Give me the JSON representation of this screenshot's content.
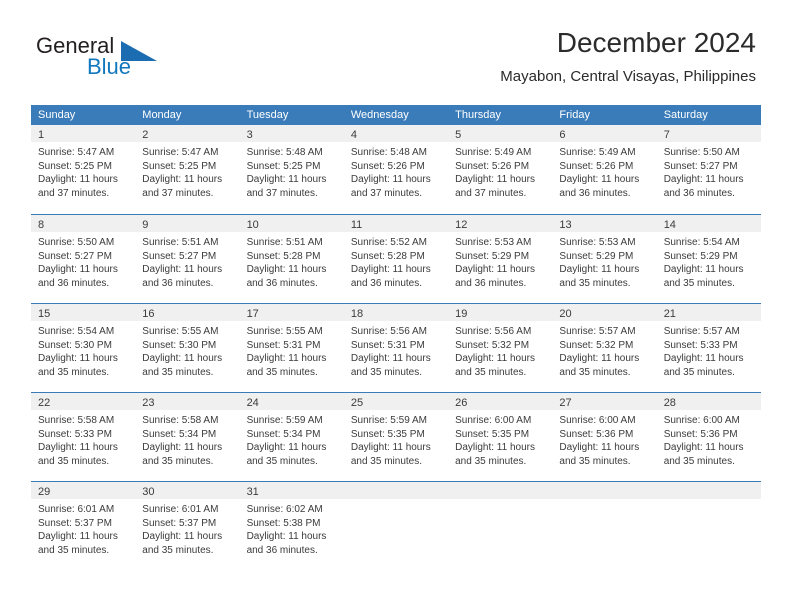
{
  "brand": {
    "name_top": "General",
    "name_bottom": "Blue",
    "accent_color": "#1b6cb0",
    "text_color": "#231f20"
  },
  "header": {
    "title": "December 2024",
    "subtitle": "Mayabon, Central Visayas, Philippines"
  },
  "calendar": {
    "header_bg": "#3a7cba",
    "daynum_bg": "#f0f0f0",
    "weekday_headers": [
      "Sunday",
      "Monday",
      "Tuesday",
      "Wednesday",
      "Thursday",
      "Friday",
      "Saturday"
    ],
    "weeks": [
      [
        {
          "day": "1",
          "lines": [
            "Sunrise: 5:47 AM",
            "Sunset: 5:25 PM",
            "Daylight: 11 hours",
            "and 37 minutes."
          ]
        },
        {
          "day": "2",
          "lines": [
            "Sunrise: 5:47 AM",
            "Sunset: 5:25 PM",
            "Daylight: 11 hours",
            "and 37 minutes."
          ]
        },
        {
          "day": "3",
          "lines": [
            "Sunrise: 5:48 AM",
            "Sunset: 5:25 PM",
            "Daylight: 11 hours",
            "and 37 minutes."
          ]
        },
        {
          "day": "4",
          "lines": [
            "Sunrise: 5:48 AM",
            "Sunset: 5:26 PM",
            "Daylight: 11 hours",
            "and 37 minutes."
          ]
        },
        {
          "day": "5",
          "lines": [
            "Sunrise: 5:49 AM",
            "Sunset: 5:26 PM",
            "Daylight: 11 hours",
            "and 37 minutes."
          ]
        },
        {
          "day": "6",
          "lines": [
            "Sunrise: 5:49 AM",
            "Sunset: 5:26 PM",
            "Daylight: 11 hours",
            "and 36 minutes."
          ]
        },
        {
          "day": "7",
          "lines": [
            "Sunrise: 5:50 AM",
            "Sunset: 5:27 PM",
            "Daylight: 11 hours",
            "and 36 minutes."
          ]
        }
      ],
      [
        {
          "day": "8",
          "lines": [
            "Sunrise: 5:50 AM",
            "Sunset: 5:27 PM",
            "Daylight: 11 hours",
            "and 36 minutes."
          ]
        },
        {
          "day": "9",
          "lines": [
            "Sunrise: 5:51 AM",
            "Sunset: 5:27 PM",
            "Daylight: 11 hours",
            "and 36 minutes."
          ]
        },
        {
          "day": "10",
          "lines": [
            "Sunrise: 5:51 AM",
            "Sunset: 5:28 PM",
            "Daylight: 11 hours",
            "and 36 minutes."
          ]
        },
        {
          "day": "11",
          "lines": [
            "Sunrise: 5:52 AM",
            "Sunset: 5:28 PM",
            "Daylight: 11 hours",
            "and 36 minutes."
          ]
        },
        {
          "day": "12",
          "lines": [
            "Sunrise: 5:53 AM",
            "Sunset: 5:29 PM",
            "Daylight: 11 hours",
            "and 36 minutes."
          ]
        },
        {
          "day": "13",
          "lines": [
            "Sunrise: 5:53 AM",
            "Sunset: 5:29 PM",
            "Daylight: 11 hours",
            "and 35 minutes."
          ]
        },
        {
          "day": "14",
          "lines": [
            "Sunrise: 5:54 AM",
            "Sunset: 5:29 PM",
            "Daylight: 11 hours",
            "and 35 minutes."
          ]
        }
      ],
      [
        {
          "day": "15",
          "lines": [
            "Sunrise: 5:54 AM",
            "Sunset: 5:30 PM",
            "Daylight: 11 hours",
            "and 35 minutes."
          ]
        },
        {
          "day": "16",
          "lines": [
            "Sunrise: 5:55 AM",
            "Sunset: 5:30 PM",
            "Daylight: 11 hours",
            "and 35 minutes."
          ]
        },
        {
          "day": "17",
          "lines": [
            "Sunrise: 5:55 AM",
            "Sunset: 5:31 PM",
            "Daylight: 11 hours",
            "and 35 minutes."
          ]
        },
        {
          "day": "18",
          "lines": [
            "Sunrise: 5:56 AM",
            "Sunset: 5:31 PM",
            "Daylight: 11 hours",
            "and 35 minutes."
          ]
        },
        {
          "day": "19",
          "lines": [
            "Sunrise: 5:56 AM",
            "Sunset: 5:32 PM",
            "Daylight: 11 hours",
            "and 35 minutes."
          ]
        },
        {
          "day": "20",
          "lines": [
            "Sunrise: 5:57 AM",
            "Sunset: 5:32 PM",
            "Daylight: 11 hours",
            "and 35 minutes."
          ]
        },
        {
          "day": "21",
          "lines": [
            "Sunrise: 5:57 AM",
            "Sunset: 5:33 PM",
            "Daylight: 11 hours",
            "and 35 minutes."
          ]
        }
      ],
      [
        {
          "day": "22",
          "lines": [
            "Sunrise: 5:58 AM",
            "Sunset: 5:33 PM",
            "Daylight: 11 hours",
            "and 35 minutes."
          ]
        },
        {
          "day": "23",
          "lines": [
            "Sunrise: 5:58 AM",
            "Sunset: 5:34 PM",
            "Daylight: 11 hours",
            "and 35 minutes."
          ]
        },
        {
          "day": "24",
          "lines": [
            "Sunrise: 5:59 AM",
            "Sunset: 5:34 PM",
            "Daylight: 11 hours",
            "and 35 minutes."
          ]
        },
        {
          "day": "25",
          "lines": [
            "Sunrise: 5:59 AM",
            "Sunset: 5:35 PM",
            "Daylight: 11 hours",
            "and 35 minutes."
          ]
        },
        {
          "day": "26",
          "lines": [
            "Sunrise: 6:00 AM",
            "Sunset: 5:35 PM",
            "Daylight: 11 hours",
            "and 35 minutes."
          ]
        },
        {
          "day": "27",
          "lines": [
            "Sunrise: 6:00 AM",
            "Sunset: 5:36 PM",
            "Daylight: 11 hours",
            "and 35 minutes."
          ]
        },
        {
          "day": "28",
          "lines": [
            "Sunrise: 6:00 AM",
            "Sunset: 5:36 PM",
            "Daylight: 11 hours",
            "and 35 minutes."
          ]
        }
      ],
      [
        {
          "day": "29",
          "lines": [
            "Sunrise: 6:01 AM",
            "Sunset: 5:37 PM",
            "Daylight: 11 hours",
            "and 35 minutes."
          ]
        },
        {
          "day": "30",
          "lines": [
            "Sunrise: 6:01 AM",
            "Sunset: 5:37 PM",
            "Daylight: 11 hours",
            "and 35 minutes."
          ]
        },
        {
          "day": "31",
          "lines": [
            "Sunrise: 6:02 AM",
            "Sunset: 5:38 PM",
            "Daylight: 11 hours",
            "and 36 minutes."
          ]
        },
        {
          "day": "",
          "lines": []
        },
        {
          "day": "",
          "lines": []
        },
        {
          "day": "",
          "lines": []
        },
        {
          "day": "",
          "lines": []
        }
      ]
    ]
  }
}
